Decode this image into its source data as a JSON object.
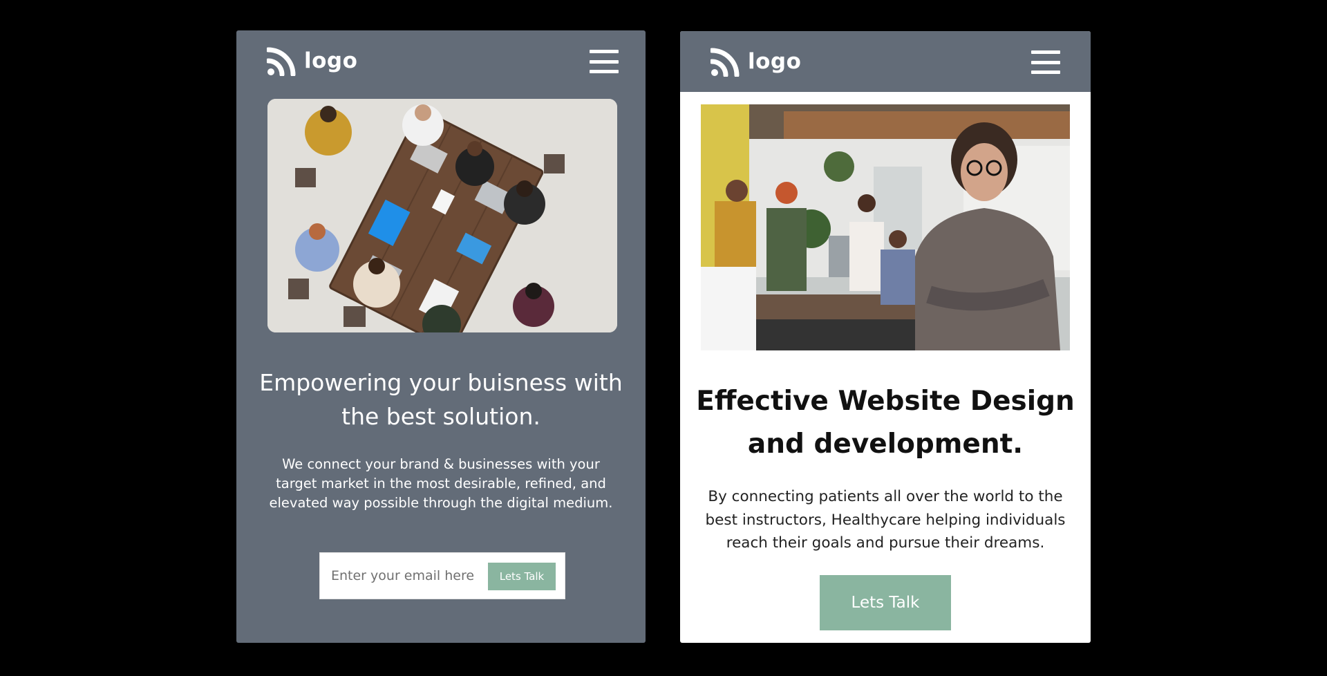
{
  "colors": {
    "page_background": "#000000",
    "card_slate": "#636c78",
    "card_white": "#ffffff",
    "accent_green": "#8ab5a0",
    "headline_dark": "#111111"
  },
  "card1": {
    "logo_text": "logo",
    "logo_icon": "rss-signal-icon",
    "menu_icon": "hamburger-menu-icon",
    "image_alt": "team-meeting-overhead-photo",
    "headline": "Empowering your buisness with the best solution.",
    "body": "We connect your brand & businesses with your target market in the most desirable, refined, and elevated way possible through the digital medium.",
    "email_placeholder": "Enter your email here",
    "cta_label": "Lets Talk"
  },
  "card2": {
    "logo_text": "logo",
    "logo_icon": "rss-signal-icon",
    "menu_icon": "hamburger-menu-icon",
    "image_alt": "woman-in-office-photo",
    "headline": "Effective Website Design and development.",
    "body": "By connecting patients all over the world to the best instructors, Healthycare helping individuals reach their goals and pursue their dreams.",
    "cta_label": "Lets Talk"
  }
}
